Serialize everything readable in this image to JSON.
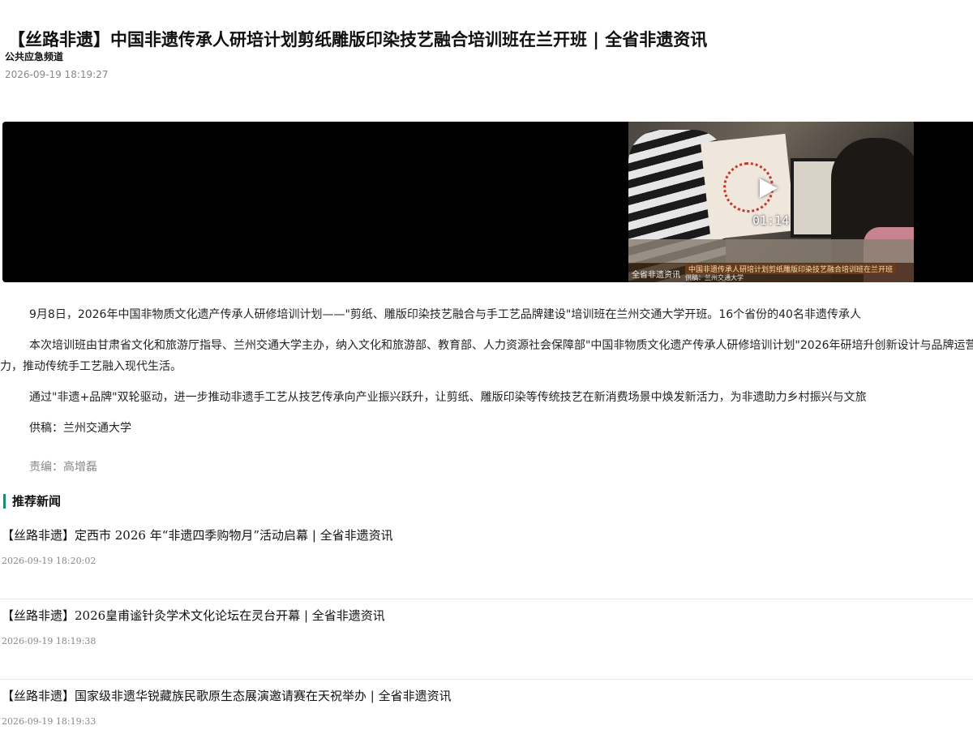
{
  "article": {
    "title": "【丝路非遗】中国非遗传承人研培计划剪纸雕版印染技艺融合培训班在兰开班 | 全省非遗资讯",
    "channel": "公共应急频道",
    "published": "2026-09-19 18:19:27",
    "video": {
      "duration": "01:14",
      "caption_logo": "全省非遗资讯",
      "caption_title": "中国非遗传承人研培计划剪纸雕版印染技艺融合培训班在兰开班",
      "caption_credit": "供稿：兰州交通大学"
    },
    "paragraphs": [
      "9月8日，2026年中国非物质文化遗产传承人研修培训计划——\"剪纸、雕版印染技艺融合与手工艺品牌建设\"培训班在兰州交通大学开班。16个省份的40名非遗传承人",
      "本次培训班由甘肃省文化和旅游厅指导、兰州交通大学主办，纳入文化和旅游部、教育部、人力资源社会保障部\"中国非物质文化遗产传承人研修培训计划\"2026年研培升创新设计与品牌运营能力，推动传统手工艺融入现代生活。",
      "通过\"非遗+品牌\"双轮驱动，进一步推动非遗手工艺从技艺传承向产业振兴跃升，让剪纸、雕版印染等传统技艺在新消费场景中焕发新活力，为非遗助力乡村振兴与文旅",
      "供稿：兰州交通大学"
    ],
    "editor": "责编：高增磊"
  },
  "recommended": {
    "heading": "推荐新闻",
    "items": [
      {
        "title": "【丝路非遗】定西市 2026 年“非遗四季购物月”活动启幕 | 全省非遗资讯",
        "time": "2026-09-19 18:20:02"
      },
      {
        "title": "【丝路非遗】2026皇甫谧针灸学术文化论坛在灵台开幕 | 全省非遗资讯",
        "time": "2026-09-19 18:19:38"
      },
      {
        "title": "【丝路非遗】国家级非遗华锐藏族民歌原生态展演邀请赛在天祝举办 | 全省非遗资讯",
        "time": "2026-09-19 18:19:33"
      }
    ]
  }
}
